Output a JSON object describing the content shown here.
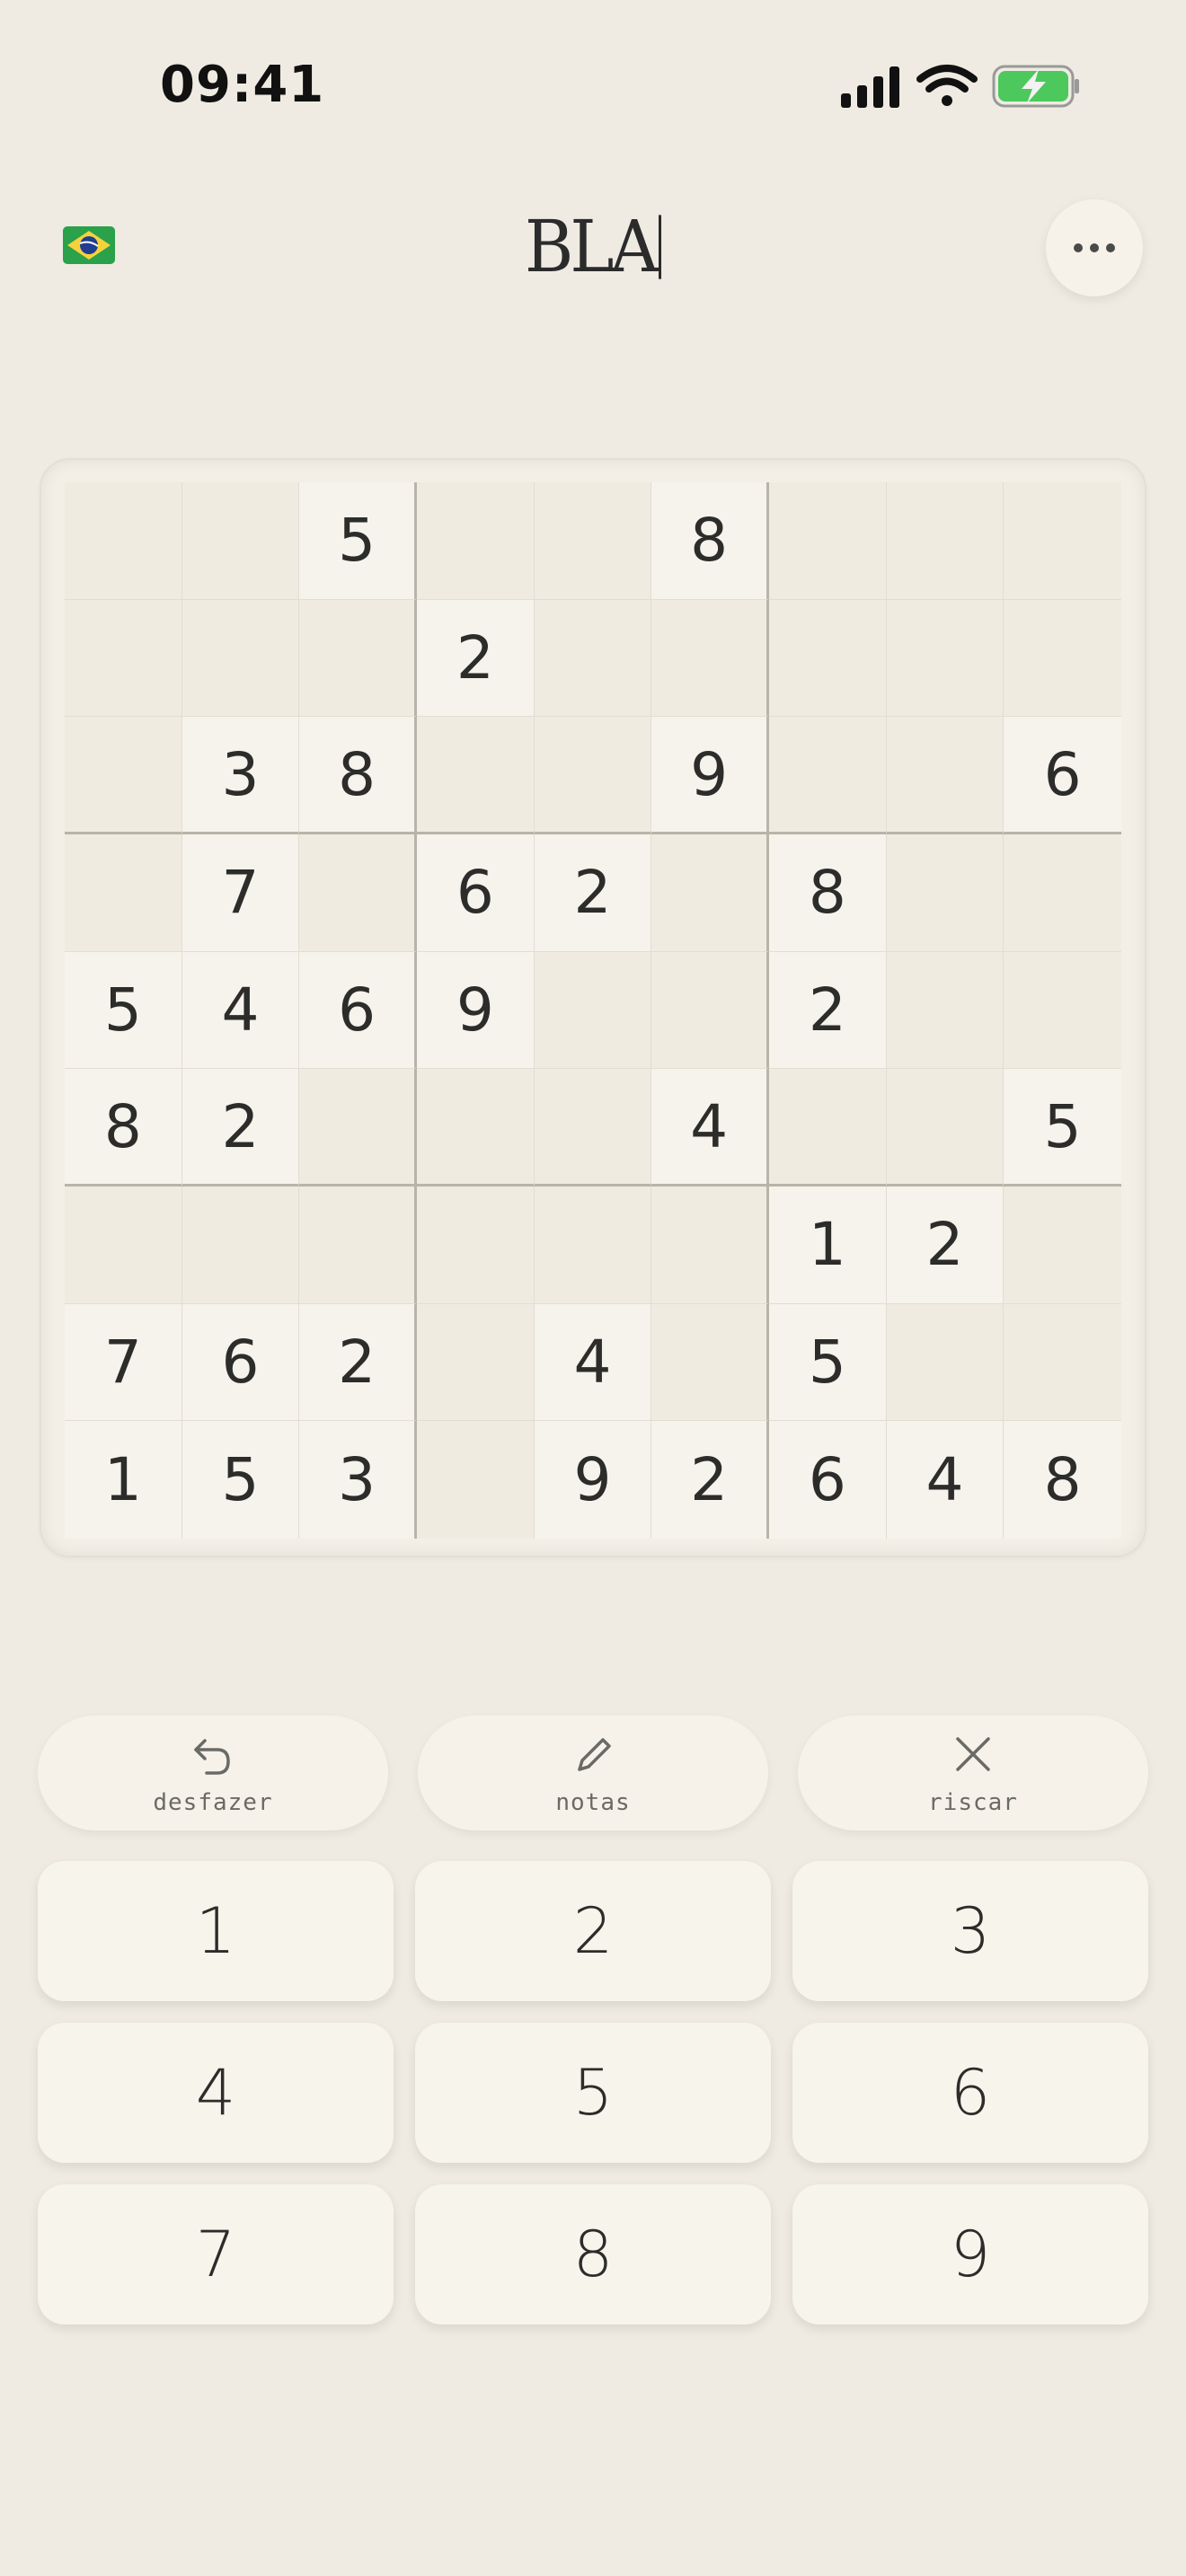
{
  "status_bar": {
    "time": "09:41"
  },
  "header": {
    "title": "BLA",
    "language_flag": "brazil-flag-icon",
    "more_icon": "more-horizontal-icon"
  },
  "board": {
    "rows": [
      [
        "",
        "",
        "5",
        "",
        "",
        "8",
        "",
        "",
        ""
      ],
      [
        "",
        "",
        "",
        "2",
        "",
        "",
        "",
        "",
        ""
      ],
      [
        "",
        "3",
        "8",
        "",
        "",
        "9",
        "",
        "",
        "6"
      ],
      [
        "",
        "7",
        "",
        "6",
        "2",
        "",
        "8",
        "",
        ""
      ],
      [
        "5",
        "4",
        "6",
        "9",
        "",
        "",
        "2",
        "",
        ""
      ],
      [
        "8",
        "2",
        "",
        "",
        "",
        "4",
        "",
        "",
        "5"
      ],
      [
        "",
        "",
        "",
        "",
        "",
        "",
        "1",
        "2",
        ""
      ],
      [
        "7",
        "6",
        "2",
        "",
        "4",
        "",
        "5",
        "",
        ""
      ],
      [
        "1",
        "5",
        "3",
        "",
        "9",
        "2",
        "6",
        "4",
        "8"
      ]
    ]
  },
  "actions": [
    {
      "label": "desfazer",
      "icon": "undo-icon"
    },
    {
      "label": "notas",
      "icon": "pencil-icon"
    },
    {
      "label": "riscar",
      "icon": "close-icon"
    }
  ],
  "keypad": {
    "keys": [
      "1",
      "2",
      "3",
      "4",
      "5",
      "6",
      "7",
      "8",
      "9"
    ]
  },
  "colors": {
    "background": "#efebe2",
    "battery_fill": "#4cc85c"
  }
}
